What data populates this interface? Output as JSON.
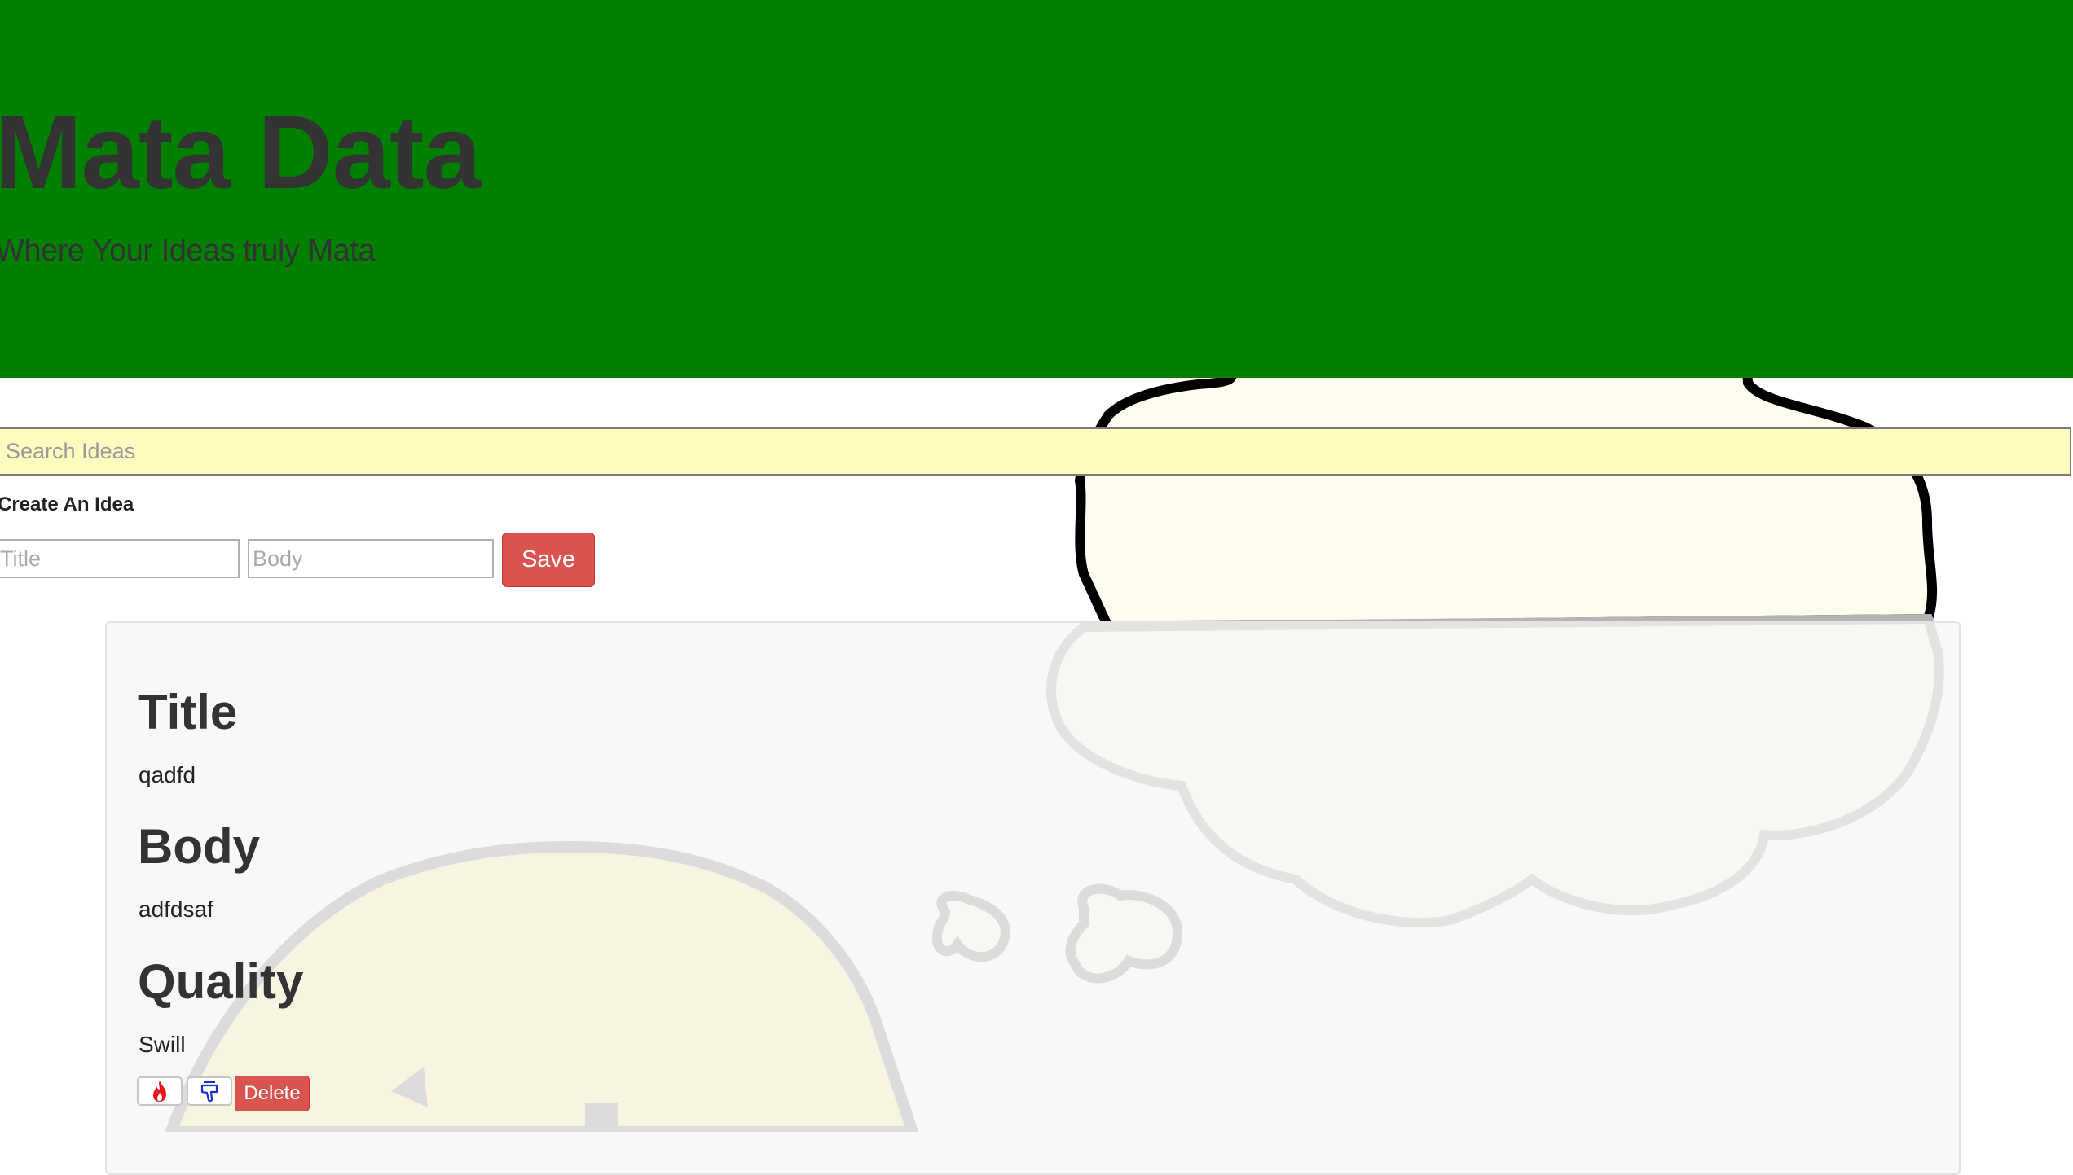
{
  "header": {
    "title": "Mata Data",
    "subtitle": "Where Your Ideas truly Mata",
    "background_color": "#008000"
  },
  "search": {
    "placeholder": "Search Ideas",
    "value": "",
    "background_color": "#fffcc0"
  },
  "create": {
    "label": "Create An Idea",
    "title_placeholder": "Title",
    "body_placeholder": "Body",
    "save_label": "Save"
  },
  "idea_card": {
    "title_heading": "Title",
    "title_value": "qadfd",
    "body_heading": "Body",
    "body_value": "adfdsaf",
    "quality_heading": "Quality",
    "quality_value": "Swill",
    "upvote_icon": "flame-icon",
    "downvote_icon": "thumbs-down-icon",
    "delete_label": "Delete"
  },
  "colors": {
    "danger": "#d9534f",
    "card_bg": "#f5f5f5",
    "text": "#333333"
  }
}
